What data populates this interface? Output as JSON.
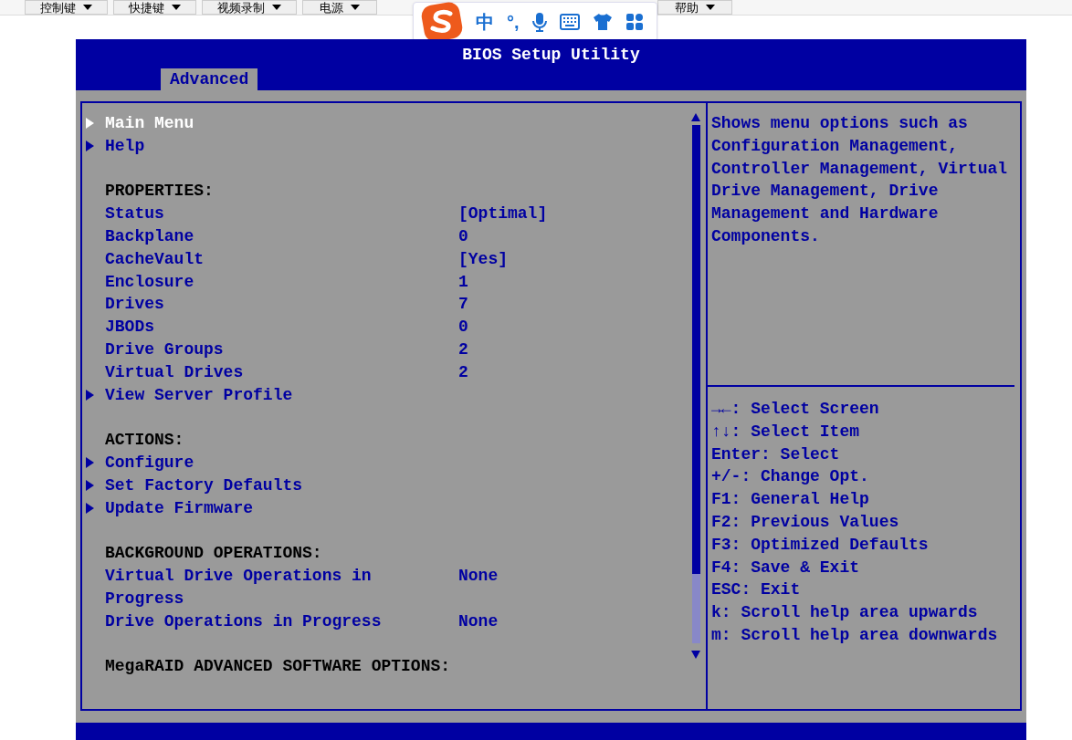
{
  "toolbar_menus": [
    {
      "label": "控制键"
    },
    {
      "label": "快捷键"
    },
    {
      "label": "视频录制"
    },
    {
      "label": "电源"
    },
    {
      "label": "帮助"
    }
  ],
  "ime_toolbar": {
    "items": [
      "中",
      "°,"
    ]
  },
  "bios": {
    "title": "BIOS Setup Utility",
    "tabs": [
      {
        "label": "Advanced",
        "selected": true
      }
    ],
    "items": [
      {
        "kind": "submenu",
        "label": "Main Menu",
        "selected": true
      },
      {
        "kind": "submenu",
        "label": "Help",
        "selected": false
      },
      {
        "kind": "heading",
        "label": "PROPERTIES:"
      },
      {
        "kind": "property",
        "label": "Status",
        "value": "[Optimal]"
      },
      {
        "kind": "property",
        "label": "Backplane",
        "value": "0"
      },
      {
        "kind": "property",
        "label": "CacheVault",
        "value": "[Yes]"
      },
      {
        "kind": "property",
        "label": "Enclosure",
        "value": "1"
      },
      {
        "kind": "property",
        "label": "Drives",
        "value": "7"
      },
      {
        "kind": "property",
        "label": "JBODs",
        "value": "0"
      },
      {
        "kind": "property",
        "label": "Drive Groups",
        "value": "2"
      },
      {
        "kind": "property",
        "label": "Virtual Drives",
        "value": "2"
      },
      {
        "kind": "submenu",
        "label": "View Server Profile",
        "selected": false
      },
      {
        "kind": "heading",
        "label": "ACTIONS:"
      },
      {
        "kind": "submenu",
        "label": "Configure",
        "selected": false
      },
      {
        "kind": "submenu",
        "label": "Set Factory Defaults",
        "selected": false
      },
      {
        "kind": "submenu",
        "label": "Update Firmware",
        "selected": false
      },
      {
        "kind": "heading",
        "label": "BACKGROUND OPERATIONS:"
      },
      {
        "kind": "property",
        "label": "Virtual Drive Operations in Progress",
        "value": "None"
      },
      {
        "kind": "property",
        "label": "Drive Operations in Progress",
        "value": "None"
      },
      {
        "kind": "heading",
        "label": "MegaRAID ADVANCED SOFTWARE OPTIONS:"
      }
    ],
    "help_text": "Shows menu options such as Configuration Management, Controller Management, Virtual Drive Management, Drive Management and Hardware Components.",
    "key_help": [
      "→←: Select Screen",
      "↑↓: Select Item",
      "Enter: Select",
      "+/-: Change Opt.",
      "F1: General Help",
      "F2: Previous Values",
      "F3: Optimized Defaults",
      "F4: Save & Exit",
      "ESC: Exit",
      "k: Scroll help area upwards",
      "m: Scroll help area downwards"
    ]
  }
}
